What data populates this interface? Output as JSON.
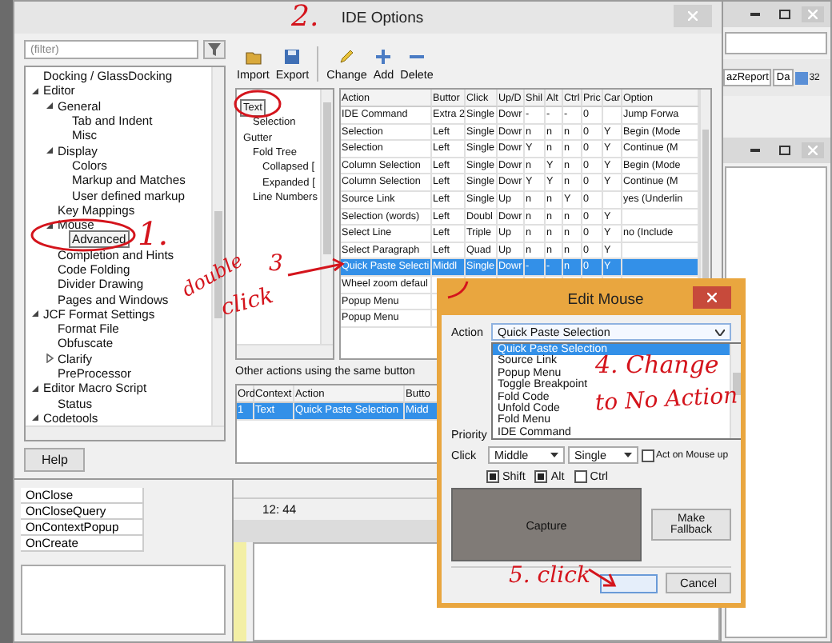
{
  "background_window": {
    "tabs": [
      "azReport",
      "Da"
    ],
    "badge": "32"
  },
  "ide_options": {
    "title": "IDE Options",
    "filter": {
      "placeholder": "(filter)"
    },
    "tree": [
      {
        "label": "Docking / GlassDocking",
        "selected": false
      },
      {
        "label": "Editor",
        "selected": false,
        "expanded": true,
        "children": [
          {
            "label": "General",
            "selected": false,
            "expanded": true,
            "children": [
              {
                "label": "Tab and Indent",
                "selected": false
              },
              {
                "label": "Misc",
                "selected": false
              }
            ]
          },
          {
            "label": "Display",
            "selected": false,
            "expanded": true,
            "children": [
              {
                "label": "Colors",
                "selected": false
              },
              {
                "label": "Markup and Matches",
                "selected": false
              },
              {
                "label": "User defined markup",
                "selected": false
              }
            ]
          },
          {
            "label": "Key Mappings",
            "selected": false
          },
          {
            "label": "Mouse",
            "selected": false,
            "expanded": true,
            "children": [
              {
                "label": "Advanced",
                "selected": true
              }
            ]
          },
          {
            "label": "Completion and Hints",
            "selected": false
          },
          {
            "label": "Code Folding",
            "selected": false
          },
          {
            "label": "Divider Drawing",
            "selected": false
          },
          {
            "label": "Pages and Windows",
            "selected": false
          }
        ]
      },
      {
        "label": "JCF Format Settings",
        "selected": false,
        "expanded": true,
        "children": [
          {
            "label": "Format File",
            "selected": false
          },
          {
            "label": "Obfuscate",
            "selected": false
          },
          {
            "label": "Clarify",
            "selected": false,
            "expanded": false
          },
          {
            "label": "PreProcessor",
            "selected": false
          }
        ]
      },
      {
        "label": "Editor Macro Script",
        "selected": false,
        "expanded": true,
        "children": [
          {
            "label": "Status",
            "selected": false
          }
        ]
      },
      {
        "label": "Codetools",
        "selected": false,
        "expanded": true
      }
    ],
    "help_button": "Help",
    "toolbar": [
      {
        "label": "Import",
        "kind": "import"
      },
      {
        "label": "Export",
        "kind": "export"
      },
      {
        "label": "Change",
        "kind": "change"
      },
      {
        "label": "Add",
        "kind": "add"
      },
      {
        "label": "Delete",
        "kind": "delete"
      }
    ],
    "context_tree": [
      {
        "label": "Text",
        "selected": true,
        "children": [
          {
            "label": "Selection",
            "selected": false
          }
        ]
      },
      {
        "label": "Gutter",
        "selected": false,
        "children": [
          {
            "label": "Fold Tree",
            "selected": false,
            "children": [
              {
                "label": "Collapsed [",
                "selected": false
              },
              {
                "label": "Expanded [",
                "selected": false
              }
            ]
          },
          {
            "label": "Line Numbers",
            "selected": false
          }
        ]
      }
    ],
    "actions_table": {
      "columns": [
        "Action",
        "Buttor",
        "Click",
        "Up/D",
        "Shil",
        "Alt",
        "Ctrl",
        "Pric",
        "Car",
        "Option"
      ],
      "rows": [
        {
          "selected": false,
          "cells": [
            "IDE Command",
            "Extra 2",
            "Single",
            "Dowr",
            "-",
            "-",
            "-",
            "0",
            null,
            "Jump Forwa"
          ]
        },
        {
          "selected": false,
          "cells": [
            "Selection",
            "Left",
            "Single",
            "Dowr",
            "n",
            "n",
            "n",
            "0",
            "Y",
            "Begin (Mode"
          ]
        },
        {
          "selected": false,
          "cells": [
            "Selection",
            "Left",
            "Single",
            "Dowr",
            "Y",
            "n",
            "n",
            "0",
            "Y",
            "Continue (M"
          ]
        },
        {
          "selected": false,
          "cells": [
            "Column Selection",
            "Left",
            "Single",
            "Dowr",
            "n",
            "Y",
            "n",
            "0",
            "Y",
            "Begin (Mode"
          ]
        },
        {
          "selected": false,
          "cells": [
            "Column Selection",
            "Left",
            "Single",
            "Dowr",
            "Y",
            "Y",
            "n",
            "0",
            "Y",
            "Continue (M"
          ]
        },
        {
          "selected": false,
          "cells": [
            "Source Link",
            "Left",
            "Single",
            "Up",
            "n",
            "n",
            "Y",
            "0",
            null,
            "yes (Underlin"
          ]
        },
        {
          "selected": false,
          "cells": [
            "Selection (words)",
            "Left",
            "Doubl",
            "Dowr",
            "n",
            "n",
            "n",
            "0",
            "Y",
            null
          ]
        },
        {
          "selected": false,
          "cells": [
            "Select Line",
            "Left",
            "Triple",
            "Up",
            "n",
            "n",
            "n",
            "0",
            "Y",
            "no (Include"
          ]
        },
        {
          "selected": false,
          "cells": [
            "Select Paragraph",
            "Left",
            "Quad",
            "Up",
            "n",
            "n",
            "n",
            "0",
            "Y",
            null
          ]
        },
        {
          "selected": true,
          "cells": [
            "Quick Paste Selecti",
            "Middl",
            "Single",
            "Dowr",
            "-",
            "-",
            "n",
            "0",
            "Y",
            null
          ]
        },
        {
          "selected": false,
          "cells": [
            "Wheel zoom defaul"
          ]
        },
        {
          "selected": false,
          "cells": [
            "Popup Menu"
          ]
        },
        {
          "selected": false,
          "cells": [
            "Popup Menu"
          ]
        }
      ]
    },
    "same_button_label": "Other actions using the same button",
    "same_button_table": {
      "columns": [
        "Ord",
        "Context",
        "Action",
        "Butto"
      ],
      "rows": [
        {
          "selected": true,
          "cells": [
            "1",
            "Text",
            "Quick Paste Selection",
            "Midd"
          ]
        }
      ]
    }
  },
  "object_inspector": {
    "events": [
      "OnClose",
      "OnCloseQuery",
      "OnContextPopup",
      "OnCreate"
    ]
  },
  "source_editor": {
    "cursor_position": "12: 44"
  },
  "edit_mouse": {
    "title": "Edit Mouse",
    "action_label": "Action",
    "action_value": "Quick Paste Selection",
    "action_options": [
      {
        "label": "Quick Paste Selection",
        "selected": true
      },
      {
        "label": "Source Link",
        "selected": false
      },
      {
        "label": "Popup Menu",
        "selected": false
      },
      {
        "label": "Toggle Breakpoint",
        "selected": false
      },
      {
        "label": "Fold Code",
        "selected": false
      },
      {
        "label": "Unfold Code",
        "selected": false
      },
      {
        "label": "Fold Menu",
        "selected": false
      },
      {
        "label": "IDE Command",
        "selected": false
      }
    ],
    "priority_label": "Priority",
    "click_label": "Click",
    "button_value": "Middle",
    "click_value": "Single",
    "mouse_up": {
      "label": "Act on Mouse up",
      "checked": false
    },
    "modifiers": [
      {
        "label": "Shift",
        "checked": true
      },
      {
        "label": "Alt",
        "checked": true
      },
      {
        "label": "Ctrl",
        "checked": false
      }
    ],
    "capture_label": "Capture",
    "fallback_button": "Make Fallback",
    "cancel_button": "Cancel"
  },
  "annotations": [
    {
      "text": "1."
    },
    {
      "text": "2."
    },
    {
      "text": "double"
    },
    {
      "text": "3"
    },
    {
      "text": "click"
    },
    {
      "text": "4. Change"
    },
    {
      "text": "to No Action"
    },
    {
      "text": "5. click"
    }
  ]
}
